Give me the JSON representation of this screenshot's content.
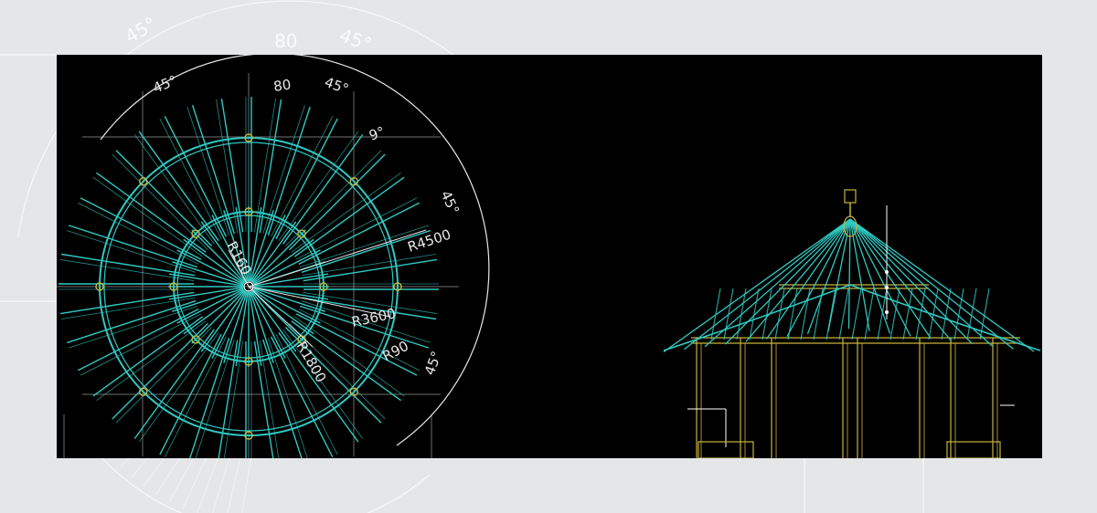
{
  "colors": {
    "background": "#e4e6e7",
    "canvas": "#000000",
    "rafter": "#2fc9c2",
    "column": "#c8b43a",
    "annotation": "#e8e8e8"
  },
  "plan_view": {
    "dimensions": {
      "angle_top_left": "45°",
      "angle_top_center": "80",
      "angle_top_right": "45°",
      "angle_small": "9°",
      "angle_right_upper": "45°",
      "angle_right_lower": "45°",
      "radius_outer": "R4500",
      "radius_middle": "R3600",
      "radius_inner": "R1800",
      "radius_hub": "R160",
      "radius_column": "R90"
    },
    "rafter_count": 40,
    "column_count": 8
  },
  "background_labels": {
    "left": "45°",
    "center": "80",
    "right": "45°"
  }
}
